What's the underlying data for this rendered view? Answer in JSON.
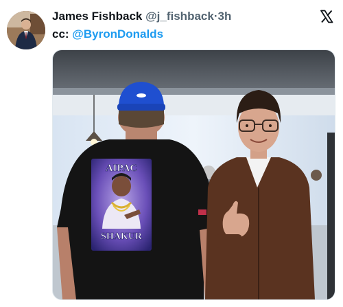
{
  "author": {
    "display_name": "James Fishback",
    "handle": "@j_fishback",
    "separator": "·",
    "time": "3h"
  },
  "tweet": {
    "prefix": "cc: ",
    "mention": "@ByronDonalds"
  },
  "photo": {
    "shirt_top_text": "AIPAC",
    "shirt_bottom_text": "SHAKUR"
  },
  "icons": {
    "avatar": "avatar",
    "platform_logo": "x-logo-icon"
  }
}
